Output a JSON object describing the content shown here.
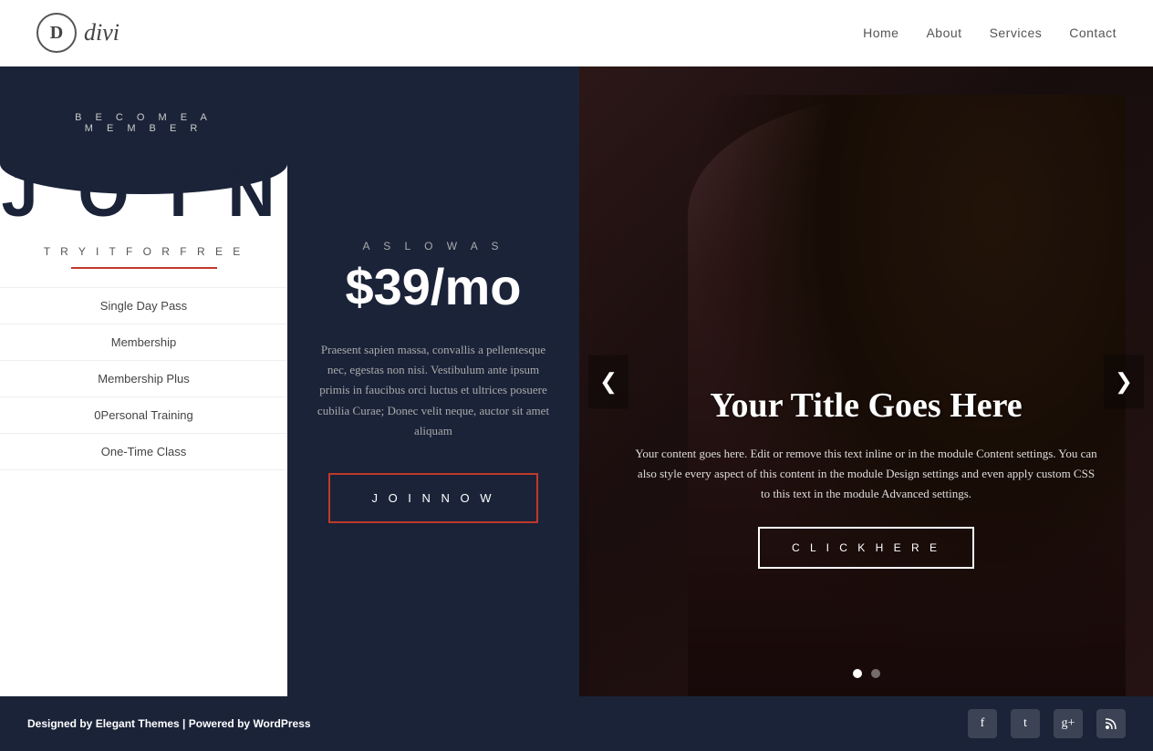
{
  "header": {
    "logo_letter": "D",
    "logo_name": "divi",
    "nav": [
      {
        "label": "Home",
        "key": "home"
      },
      {
        "label": "About",
        "key": "about"
      },
      {
        "label": "Services",
        "key": "services"
      },
      {
        "label": "Contact",
        "key": "contact"
      }
    ]
  },
  "left_panel": {
    "become_member_line1": "B E C O M E   A",
    "become_member_line2": "M E M B E R",
    "join_text": "J O I N",
    "try_free": "T R Y   I T   F O R   F R E E",
    "menu_items": [
      {
        "label": "Single Day Pass"
      },
      {
        "label": "Membership"
      },
      {
        "label": "Membership Plus"
      },
      {
        "label": "0Personal Training"
      },
      {
        "label": "One-Time Class"
      }
    ]
  },
  "middle_panel": {
    "as_low_as": "A S   L O W   A S",
    "price": "$39/mo",
    "description": "Praesent sapien massa, convallis a pellentesque nec, egestas non nisi. Vestibulum ante ipsum primis in faucibus orci luctus et ultrices posuere cubilia Curae; Donec velit neque, auctor sit amet aliquam",
    "join_button": "J O I N   N O W"
  },
  "slider": {
    "title": "Your Title Goes Here",
    "description": "Your content goes here. Edit or remove this text inline or in the module Content settings. You can also style every aspect of this content in the module Design settings and even apply custom CSS to this text in the module Advanced settings.",
    "cta_button": "C L I C K   H E R E",
    "arrow_left": "❮",
    "arrow_right": "❯",
    "dots": [
      {
        "active": true
      },
      {
        "active": false
      }
    ]
  },
  "footer": {
    "designed_by": "Designed by ",
    "elegant_themes": "Elegant Themes",
    "separator": " | Powered by ",
    "wordpress": "WordPress",
    "icons": [
      {
        "name": "facebook-icon",
        "symbol": "f"
      },
      {
        "name": "twitter-icon",
        "symbol": "t"
      },
      {
        "name": "googleplus-icon",
        "symbol": "g+"
      },
      {
        "name": "rss-icon",
        "symbol": "rss"
      }
    ]
  }
}
